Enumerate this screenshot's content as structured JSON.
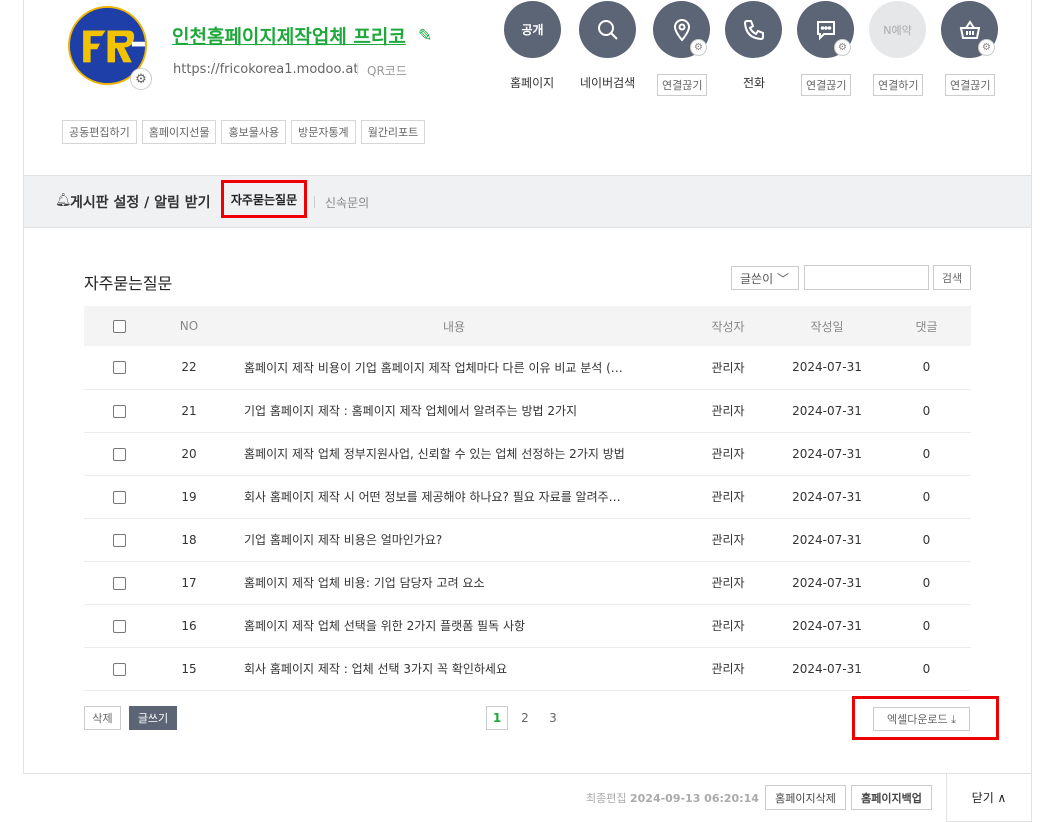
{
  "profile": {
    "title": "인천홈페이지제작업체 프리코",
    "url": "https://fricokorea1.modoo.at",
    "qr": "QR코드",
    "tools": [
      "공동편집하기",
      "홈페이지선물",
      "홍보물사용",
      "방문자통계",
      "월간리포트"
    ]
  },
  "quick": [
    {
      "icon": "공개",
      "label": "홈페이지",
      "boxed": false
    },
    {
      "icon": "search-icon",
      "label": "네이버검색",
      "boxed": false
    },
    {
      "icon": "location-icon",
      "label": "연결끊기",
      "boxed": true
    },
    {
      "icon": "phone-icon",
      "label": "전화",
      "boxed": false
    },
    {
      "icon": "chat-icon",
      "label": "연결끊기",
      "boxed": true
    },
    {
      "icon": "N예약",
      "label": "연결하기",
      "boxed": true
    },
    {
      "icon": "basket-icon",
      "label": "연결끊기",
      "boxed": true
    }
  ],
  "board": {
    "settings": "게시판 설정 / 알림 받기",
    "tab_active": "자주묻는질문",
    "tab_other": "신속문의"
  },
  "list": {
    "title": "자주묻는질문",
    "search_select": "글쓴이",
    "search_button": "검색",
    "headers": {
      "no": "NO",
      "content": "내용",
      "author": "작성자",
      "date": "작성일",
      "comments": "댓글"
    },
    "rows": [
      {
        "no": "22",
        "content": "홈페이지 제작 비용이 기업 홈페이지 제작 업체마다 다른 이유 비교 분석 (…",
        "author": "관리자",
        "date": "2024-07-31",
        "comments": "0"
      },
      {
        "no": "21",
        "content": "기업 홈페이지 제작 : 홈페이지 제작 업체에서 알려주는 방법 2가지",
        "author": "관리자",
        "date": "2024-07-31",
        "comments": "0"
      },
      {
        "no": "20",
        "content": "홈페이지 제작 업체 정부지원사업, 신뢰할 수 있는 업체 선정하는 2가지 방법",
        "author": "관리자",
        "date": "2024-07-31",
        "comments": "0"
      },
      {
        "no": "19",
        "content": "회사 홈페이지 제작 시 어떤 정보를 제공해야 하나요? 필요 자료를 알려주…",
        "author": "관리자",
        "date": "2024-07-31",
        "comments": "0"
      },
      {
        "no": "18",
        "content": "기업 홈페이지 제작 비용은 얼마인가요?",
        "author": "관리자",
        "date": "2024-07-31",
        "comments": "0"
      },
      {
        "no": "17",
        "content": "홈페이지 제작 업체 비용: 기업 담당자 고려 요소",
        "author": "관리자",
        "date": "2024-07-31",
        "comments": "0"
      },
      {
        "no": "16",
        "content": "홈페이지 제작 업체 선택을 위한 2가지 플랫폼 필독 사항",
        "author": "관리자",
        "date": "2024-07-31",
        "comments": "0"
      },
      {
        "no": "15",
        "content": "회사 홈페이지 제작 : 업체 선택 3가지 꼭 확인하세요",
        "author": "관리자",
        "date": "2024-07-31",
        "comments": "0"
      }
    ],
    "delete": "삭제",
    "write": "글쓰기",
    "pages": [
      "1",
      "2",
      "3"
    ],
    "excel": "엑셀다운로드 ⤓"
  },
  "footer": {
    "last_edit_label": "최종편집",
    "last_edit_time": "2024-09-13 06:20:14",
    "delete_site": "홈페이지삭제",
    "backup": "홈페이지백업",
    "close": "닫기 ∧"
  },
  "colors": {
    "accent": "#1fa83c",
    "dark": "#5c6575",
    "highlight": "#ee0000"
  }
}
